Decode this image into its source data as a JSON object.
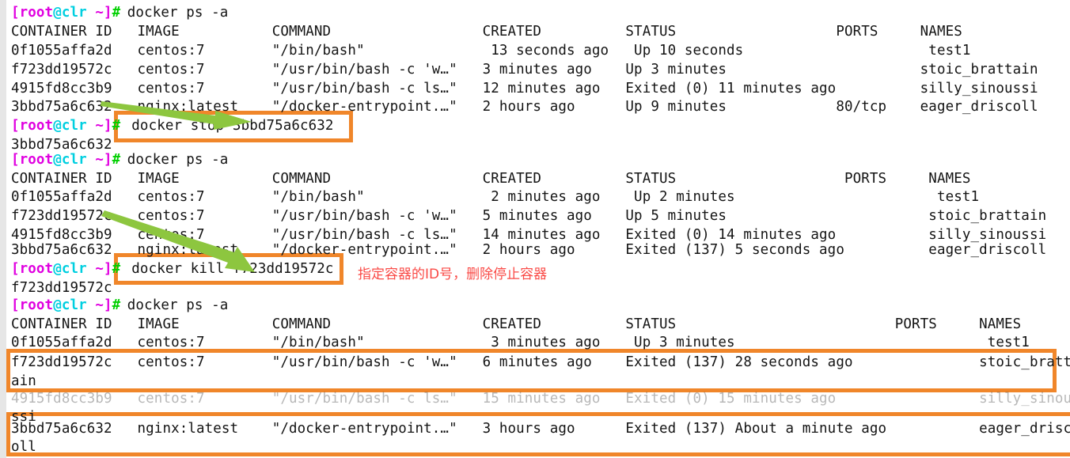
{
  "terminal": {
    "prompt": {
      "user_host": "[root@clr",
      "path": " ~]",
      "sigil": "#"
    },
    "colors": {
      "prompt_magenta": "#e000e0",
      "prompt_cyan": "#00cfe0",
      "prompt_green": "#00d000",
      "text": "#141414",
      "background": "#ffffff",
      "gutter": "#e6e6e6",
      "highlight_orange": "#f0862a",
      "arrow_green": "#8dc63f",
      "annotation_red": "#fa4a46"
    },
    "lines": [
      {
        "id": "l01",
        "type": "prompt",
        "command": "docker ps -a"
      },
      {
        "id": "l02",
        "type": "header",
        "text": "CONTAINER ID   IMAGE           COMMAND                  CREATED          STATUS                   PORTS     NAMES"
      },
      {
        "id": "l03",
        "type": "output",
        "text": "0f1055affa2d   centos:7        \"/bin/bash\"               13 seconds ago   Up 10 seconds                      test1"
      },
      {
        "id": "l04",
        "type": "output",
        "text": "f723dd19572c   centos:7        \"/usr/bin/bash -c 'w…\"   3 minutes ago    Up 3 minutes                       stoic_brattain"
      },
      {
        "id": "l05",
        "type": "output",
        "text": "4915fd8cc3b9   centos:7        \"/usr/bin/bash -c ls…\"   12 minutes ago   Exited (0) 11 minutes ago          silly_sinoussi"
      },
      {
        "id": "l06",
        "type": "output",
        "text": "3bbd75a6c632   nginx:latest    \"/docker-entrypoint.…\"   2 hours ago      Up 9 minutes             80/tcp    eager_driscoll"
      },
      {
        "id": "l07",
        "type": "prompt",
        "command": "docker stop 3bbd75a6c632"
      },
      {
        "id": "l08",
        "type": "output",
        "text": "3bbd75a6c632"
      },
      {
        "id": "l09",
        "type": "prompt",
        "command": "docker ps -a"
      },
      {
        "id": "l10",
        "type": "header",
        "text": "CONTAINER ID   IMAGE           COMMAND                  CREATED          STATUS                    PORTS     NAMES"
      },
      {
        "id": "l11",
        "type": "output",
        "text": "0f1055affa2d   centos:7        \"/bin/bash\"               2 minutes ago    Up 2 minutes                        test1"
      },
      {
        "id": "l12",
        "type": "output",
        "text": "f723dd19572c   centos:7        \"/usr/bin/bash -c 'w…\"   5 minutes ago    Up 5 minutes                        stoic_brattain"
      },
      {
        "id": "l13",
        "type": "output",
        "text": "4915fd8cc3b9   centos:7        \"/usr/bin/bash -c ls…\"   14 minutes ago   Exited (0) 14 minutes ago           silly_sinoussi"
      },
      {
        "id": "l14",
        "type": "output",
        "text": "3bbd75a6c632   nginx:latest    \"/docker-entrypoint.…\"   2 hours ago      Exited (137) 5 seconds ago          eager_driscoll"
      },
      {
        "id": "l15",
        "type": "prompt",
        "command": "docker kill f723dd19572c"
      },
      {
        "id": "l16",
        "type": "output",
        "text": "f723dd19572c"
      },
      {
        "id": "l17",
        "type": "prompt",
        "command": "docker ps -a"
      },
      {
        "id": "l18",
        "type": "header",
        "text": "CONTAINER ID   IMAGE           COMMAND                  CREATED          STATUS                          PORTS     NAMES"
      },
      {
        "id": "l19",
        "type": "output",
        "text": "0f1055affa2d   centos:7        \"/bin/bash\"               3 minutes ago    Up 3 minutes                              test1"
      },
      {
        "id": "l20",
        "type": "output",
        "text": "f723dd19572c   centos:7        \"/usr/bin/bash -c 'w…\"   6 minutes ago    Exited (137) 28 seconds ago               stoic_bratt"
      },
      {
        "id": "l21",
        "type": "output",
        "text": "ain"
      },
      {
        "id": "l22",
        "type": "output",
        "text": "4915fd8cc3b9   centos:7        \"/usr/bin/bash -c ls…\"   15 minutes ago   Exited (0) 15 minutes ago                 silly_sinou"
      },
      {
        "id": "l23",
        "type": "output",
        "text": "ssi"
      },
      {
        "id": "l24",
        "type": "output",
        "text": "3bbd75a6c632   nginx:latest    \"/docker-entrypoint.…\"   3 hours ago      Exited (137) About a minute ago           eager_drisc"
      },
      {
        "id": "l25",
        "type": "output",
        "text": "oll"
      }
    ]
  },
  "annotations": {
    "note_chinese": "指定容器的ID号，删除停止容器"
  },
  "highlights": {
    "stop_command_box": "docker stop 3bbd75a6c632",
    "kill_command_box": "docker kill f723dd19572c",
    "row_stoic_brattain": "f723dd19572c stoic_bratt ain",
    "row_eager_driscoll": "3bbd75a6c632 eager_drisc oll"
  }
}
